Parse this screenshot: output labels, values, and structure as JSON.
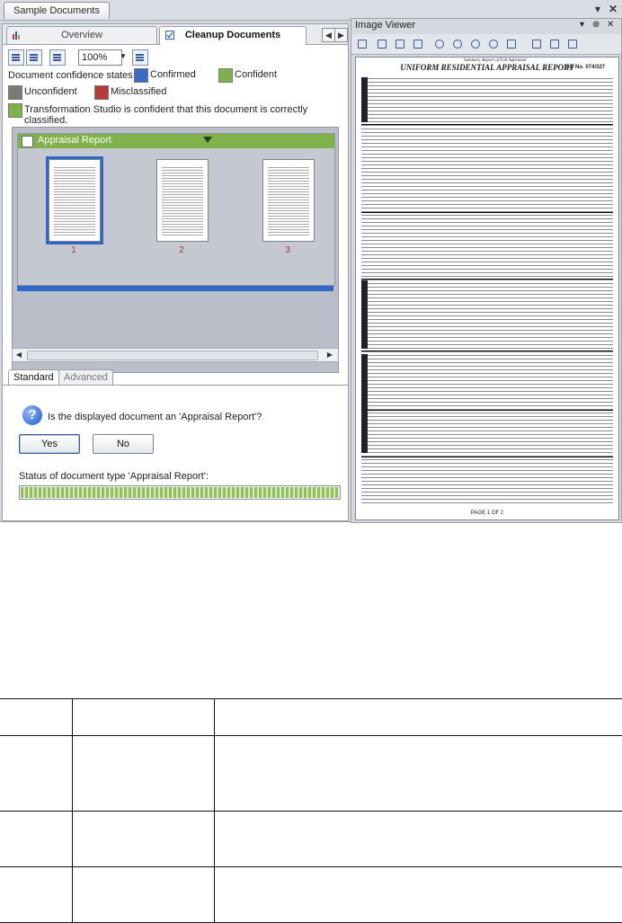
{
  "window": {
    "document_tab": "Sample Documents",
    "controls": {
      "down": "▾",
      "close": "✕"
    }
  },
  "left_pane": {
    "tabs": [
      {
        "label": "Overview"
      },
      {
        "label": "Cleanup Documents"
      }
    ],
    "tab_nav": {
      "prev": "◀",
      "next": "▶"
    },
    "toolbar": {
      "zoom_value": "100%",
      "zoom_arrow": "▼"
    },
    "legend": {
      "title": "Document confidence states:",
      "items": [
        {
          "label": "Confirmed",
          "color": "#3a6bc7"
        },
        {
          "label": "Confident",
          "color": "#7fb24a"
        },
        {
          "label": "Unconfident",
          "color": "#7a7a7a"
        },
        {
          "label": "Misclassified",
          "color": "#b63a3a"
        },
        {
          "label": "Transformation Studio is confident that this document is correctly classified.",
          "color": "#7fb24a"
        }
      ]
    },
    "group": {
      "title": "Appraisal Report",
      "pages": [
        "1",
        "2",
        "3"
      ],
      "selected_page": "1"
    },
    "bottom_tabs": [
      {
        "label": "Standard"
      },
      {
        "label": "Advanced"
      }
    ],
    "question_icon": "?",
    "question": "Is the displayed document an 'Appraisal Report'?",
    "buttons": {
      "yes": "Yes",
      "no": "No"
    },
    "status_label": "Status of document type 'Appraisal Report':",
    "status_progress": 1.0
  },
  "image_viewer": {
    "title": "Image Viewer",
    "controls": {
      "dropdown": "▾",
      "pin": "⊕",
      "close": "✕"
    },
    "document": {
      "header_small": "Summary Report of Full Appraisal",
      "title": "UNIFORM RESIDENTIAL APPRAISAL REPORT",
      "file_no": "File No. 074/327",
      "page_footer": "PAGE 1 OF 2"
    }
  }
}
